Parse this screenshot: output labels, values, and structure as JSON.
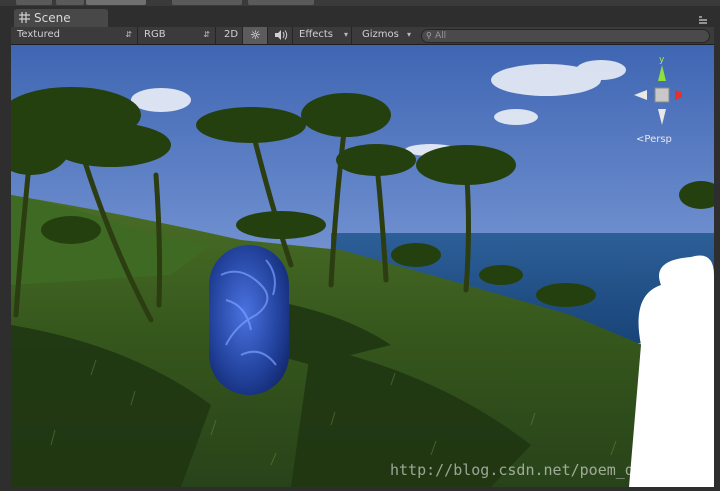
{
  "scene_tab": {
    "label": "Scene",
    "icon": "scene-grid-icon"
  },
  "toolbar": {
    "draw_mode": "Textured",
    "render_mode": "RGB",
    "toggle_2d": "2D",
    "lighting_icon": "sun-icon",
    "audio_icon": "speaker-icon",
    "effects": "Effects",
    "gizmos": "Gizmos",
    "search_placeholder": "All"
  },
  "gizmo": {
    "y_axis": "y",
    "projection": "Persp"
  },
  "watermark": "http://blog.csdn.net/poem_qian",
  "colors": {
    "sky_top": "#4a6fb8",
    "sea": "#1f4f86",
    "capsule": "#2a4fb8",
    "grass": "#3a5a1e"
  }
}
